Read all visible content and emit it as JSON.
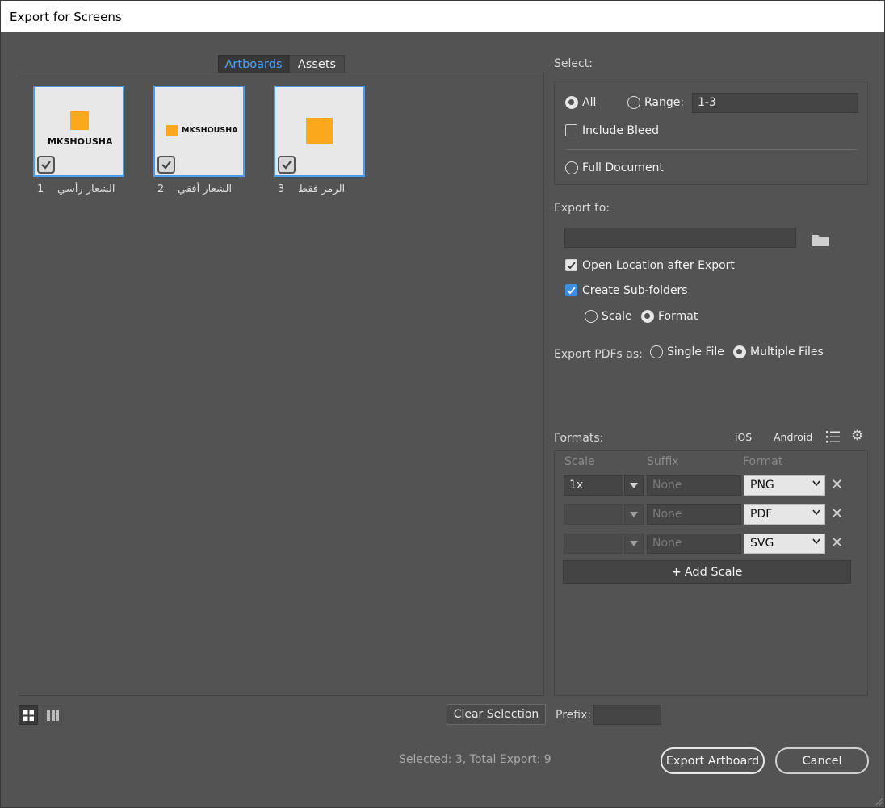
{
  "window": {
    "title": "Export for Screens"
  },
  "tabs": {
    "artboards": "Artboards",
    "assets": "Assets"
  },
  "artboards": [
    {
      "number": "1",
      "name": "الشعار رأسي",
      "logo_text": "MKSHOUSHA"
    },
    {
      "number": "2",
      "name": "الشعار أفقي",
      "logo_text": "MKSHOUSHA"
    },
    {
      "number": "3",
      "name": "الرمز فقط"
    }
  ],
  "select": {
    "label": "Select:",
    "all": "All",
    "range": "Range:",
    "range_value": "1-3",
    "include_bleed": "Include Bleed",
    "full_document": "Full Document"
  },
  "export_to": {
    "label": "Export to:",
    "path_value": "",
    "open_location": "Open Location after Export",
    "create_subfolders": "Create Sub-folders",
    "scale": "Scale",
    "format": "Format"
  },
  "pdf": {
    "label": "Export PDFs as:",
    "single": "Single File",
    "multiple": "Multiple Files"
  },
  "formats": {
    "label": "Formats:",
    "ios": "iOS",
    "android": "Android",
    "headers": {
      "scale": "Scale",
      "suffix": "Suffix",
      "format": "Format"
    },
    "rows": [
      {
        "scale": "1x",
        "suffix_placeholder": "None",
        "format": "PNG"
      },
      {
        "scale": "",
        "suffix_placeholder": "None",
        "format": "PDF"
      },
      {
        "scale": "",
        "suffix_placeholder": "None",
        "format": "SVG"
      }
    ],
    "add_scale": "Add Scale"
  },
  "bottom": {
    "clear_selection": "Clear Selection",
    "prefix": "Prefix:",
    "prefix_value": "",
    "status": "Selected: 3, Total Export: 9",
    "export_button": "Export Artboard",
    "cancel_button": "Cancel"
  },
  "colors": {
    "accent": "#4a9bea",
    "logo": "#fca81c"
  }
}
